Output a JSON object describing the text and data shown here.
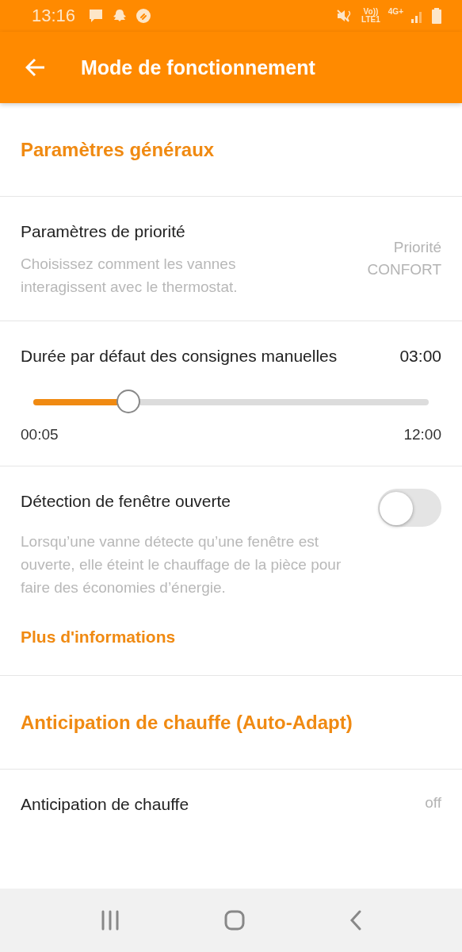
{
  "status_bar": {
    "time": "13:16",
    "network_labels": [
      "Vo))",
      "LTE1",
      "4G+"
    ]
  },
  "app_bar": {
    "title": "Mode de fonctionnement"
  },
  "sections": [
    {
      "title": "Paramètres généraux",
      "rows": [
        {
          "kind": "value",
          "title": "Paramètres de priorité",
          "description": "Choisissez comment les vannes interagissent avec le thermostat.",
          "value_lines": [
            "Priorité",
            "CONFORT"
          ]
        },
        {
          "kind": "slider",
          "title": "Durée par défaut des consignes manuelles",
          "value": "03:00",
          "level": 0.24,
          "min_label": "00:05",
          "max_label": "12:00"
        },
        {
          "kind": "toggle",
          "title": "Détection de fenêtre ouverte",
          "on": false,
          "description": "Lorsqu’une vanne détecte qu’une fenêtre est ouverte, elle éteint le chauffage de la pièce pour faire des économies d’énergie.",
          "link": "Plus d'informations"
        }
      ]
    },
    {
      "title": "Anticipation de chauffe (Auto-Adapt)",
      "rows": [
        {
          "kind": "value",
          "title": "Anticipation de chauffe",
          "value_lines": [
            "off"
          ]
        }
      ]
    }
  ]
}
